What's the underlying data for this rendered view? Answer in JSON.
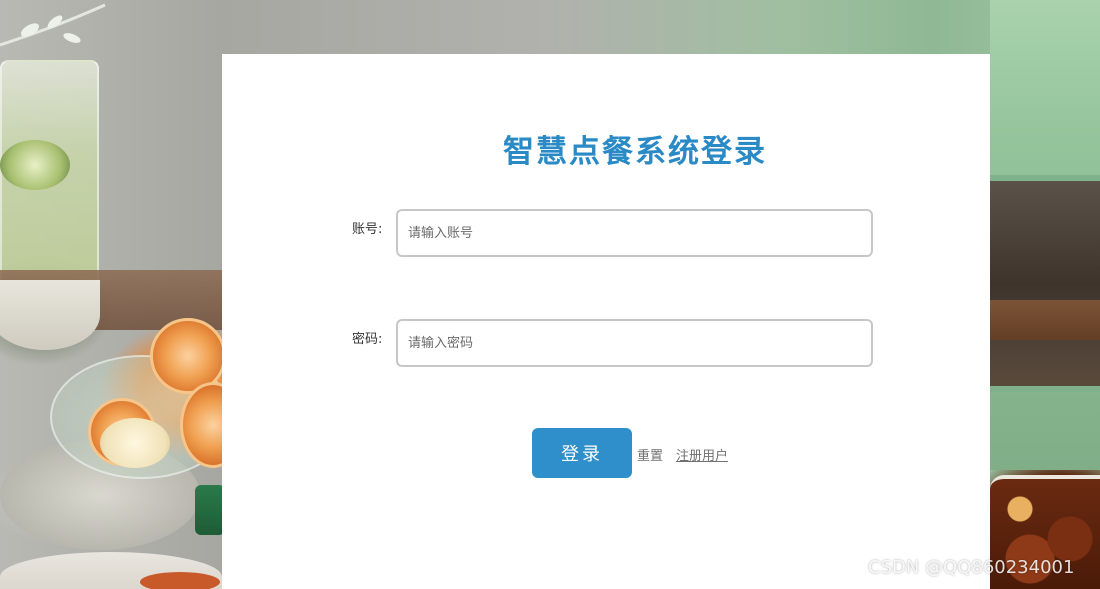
{
  "login": {
    "title": "智慧点餐系统登录",
    "account_label": "账号:",
    "account_placeholder": "请输入账号",
    "account_value": "",
    "password_label": "密码:",
    "password_placeholder": "请输入密码",
    "password_value": "",
    "login_button_label": "登录",
    "reset_link_label": "重置",
    "register_link_label": "注册用户"
  },
  "watermark": {
    "text": "CSDN @QQ860234001"
  },
  "colors": {
    "title": "#2a8ac6",
    "button_bg": "#2e8fca",
    "card_bg": "#ffffff",
    "input_border": "#c7c7c7"
  }
}
